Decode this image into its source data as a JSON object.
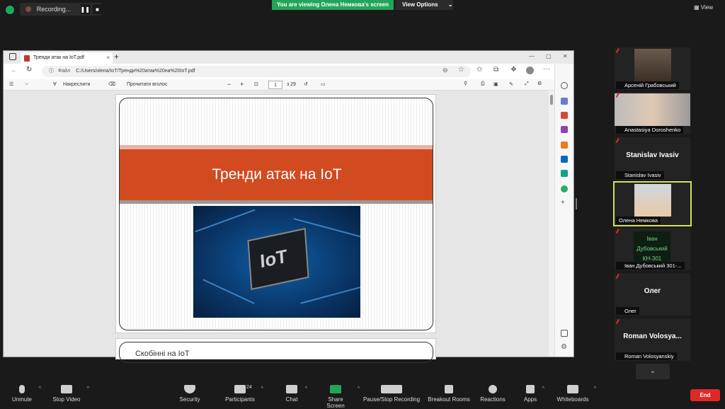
{
  "topbar": {
    "recording_label": "Recording...",
    "viewing_banner": "You are viewing Олена Немкова's screen",
    "view_options": "View Options",
    "view_options_caret": "⌄",
    "view_button": "View"
  },
  "browser": {
    "tab_title": "Тренди атак на IoT.pdf",
    "tab_close": "×",
    "new_tab": "+",
    "address_label": "Файл",
    "address": "C:/Users/olena/IoT/Тренди%20атак%20на%20IoT.pdf",
    "pdf_toolbar": {
      "draw_label": "Накреслити",
      "read_aloud_label": "Прочитати вголос",
      "page_number": "1",
      "page_total": "з 29"
    }
  },
  "slide": {
    "title": "Тренди атак на IoT",
    "chip_label": "IoT",
    "next_slide_text": "Скобінні на IoT"
  },
  "participants": [
    {
      "name": "Арсеній Грабовський",
      "muted": true
    },
    {
      "name": "Anastasiya Doroshenko",
      "muted": true
    },
    {
      "name": "Stanislav Ivasiv",
      "big": "Stanislav Ivasiv",
      "muted": true
    },
    {
      "name": "Олена Немкова",
      "muted": false
    },
    {
      "name": "Іван Дубовський 301-...",
      "big_lines": [
        "Іван",
        "Дубовський",
        "КН-301"
      ],
      "muted": true
    },
    {
      "name": "Олег",
      "big": "Олег",
      "muted": true
    },
    {
      "name": "Roman Volosyanskiy",
      "big": "Roman Volosya...",
      "muted": true
    }
  ],
  "gallery_down": "⌄",
  "toolbar": {
    "unmute": "Unmute",
    "stop_video": "Stop Video",
    "security": "Security",
    "participants": "Participants",
    "participants_count": "24",
    "chat": "Chat",
    "share_screen": "Share Screen",
    "pause_stop_recording": "Pause/Stop Recording",
    "breakout_rooms": "Breakout Rooms",
    "reactions": "Reactions",
    "apps": "Apps",
    "whiteboards": "Whiteboards",
    "end": "End"
  },
  "colors": {
    "accent_green": "#23a559",
    "end_red": "#e02828",
    "slide_band": "#d24a1f",
    "active_speaker_border": "#d4e157"
  }
}
